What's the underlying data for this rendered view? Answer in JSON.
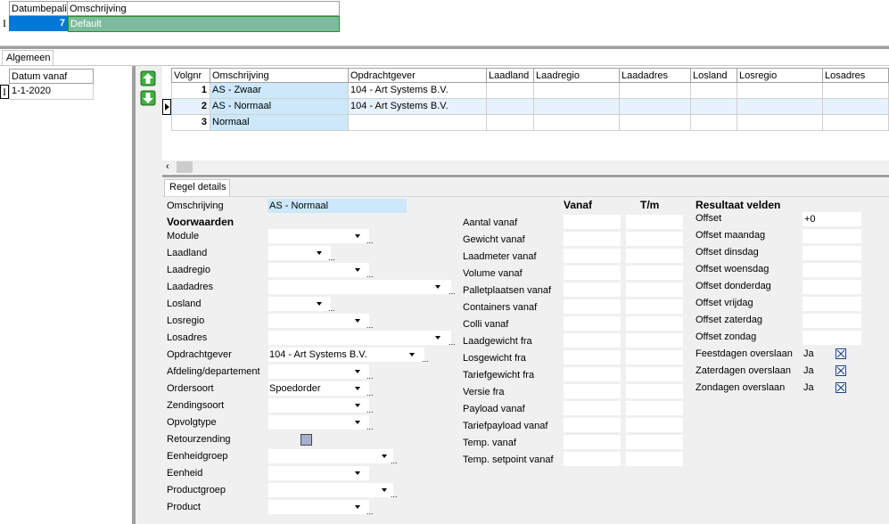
{
  "top_grid": {
    "headers": [
      "Datumbepalin",
      "Omschrijving"
    ],
    "row": {
      "num": "7",
      "desc": "Default"
    }
  },
  "tab": {
    "label": "Algemeen"
  },
  "date_grid": {
    "header": "Datum vanaf",
    "row": "1-1-2020"
  },
  "rules_grid": {
    "headers": [
      "Volgnr",
      "Omschrijving",
      "Opdrachtgever",
      "Laadland",
      "Laadregio",
      "Laadadres",
      "Losland",
      "Losregio",
      "Losadres"
    ],
    "rows": [
      {
        "num": "1",
        "desc": "AS - Zwaar",
        "client": "104 - Art Systems B.V."
      },
      {
        "num": "2",
        "desc": "AS - Normaal",
        "client": "104 - Art Systems B.V."
      },
      {
        "num": "3",
        "desc": "Normaal",
        "client": ""
      }
    ]
  },
  "details": {
    "tab": "Regel details",
    "omschrijving_label": "Omschrijving",
    "omschrijving_value": "AS - Normaal",
    "voorwaarden": "Voorwaarden",
    "fields": [
      {
        "label": "Module",
        "value": ""
      },
      {
        "label": "Laadland",
        "value": ""
      },
      {
        "label": "Laadregio",
        "value": ""
      },
      {
        "label": "Laadadres",
        "value": ""
      },
      {
        "label": "Losland",
        "value": ""
      },
      {
        "label": "Losregio",
        "value": ""
      },
      {
        "label": "Losadres",
        "value": ""
      },
      {
        "label": "Opdrachtgever",
        "value": "104 - Art Systems B.V."
      },
      {
        "label": "Afdeling/departement",
        "value": ""
      },
      {
        "label": "Ordersoort",
        "value": "Spoedorder"
      },
      {
        "label": "Zendingsoort",
        "value": ""
      },
      {
        "label": "Opvolgtype",
        "value": ""
      },
      {
        "label": "Retourzending",
        "value": ""
      },
      {
        "label": "Eenheidgroep",
        "value": ""
      },
      {
        "label": "Eenheid",
        "value": ""
      },
      {
        "label": "Productgroep",
        "value": ""
      },
      {
        "label": "Product",
        "value": ""
      }
    ],
    "range_headers": {
      "vanaf": "Vanaf",
      "tm": "T/m"
    },
    "ranges": [
      "Aantal vanaf",
      "Gewicht vanaf",
      "Laadmeter vanaf",
      "Volume vanaf",
      "Palletplaatsen vanaf",
      "Containers vanaf",
      "Colli vanaf",
      "Laadgewicht fra",
      "Losgewicht fra",
      "Tariefgewicht fra",
      "Versie fra",
      "Payload vanaf",
      "Tariefpayload vanaf",
      "Temp. vanaf",
      "Temp. setpoint vanaf"
    ],
    "result_title": "Resultaat velden",
    "results": [
      {
        "label": "Offset",
        "value": "+0"
      },
      {
        "label": "Offset maandag",
        "value": ""
      },
      {
        "label": "Offset dinsdag",
        "value": ""
      },
      {
        "label": "Offset woensdag",
        "value": ""
      },
      {
        "label": "Offset donderdag",
        "value": ""
      },
      {
        "label": "Offset vrijdag",
        "value": ""
      },
      {
        "label": "Offset zaterdag",
        "value": ""
      },
      {
        "label": "Offset zondag",
        "value": ""
      }
    ],
    "skips": [
      {
        "label": "Feestdagen overslaan",
        "value": "Ja"
      },
      {
        "label": "Zaterdagen overslaan",
        "value": "Ja"
      },
      {
        "label": "Zondagen overslaan",
        "value": "Ja"
      }
    ]
  }
}
